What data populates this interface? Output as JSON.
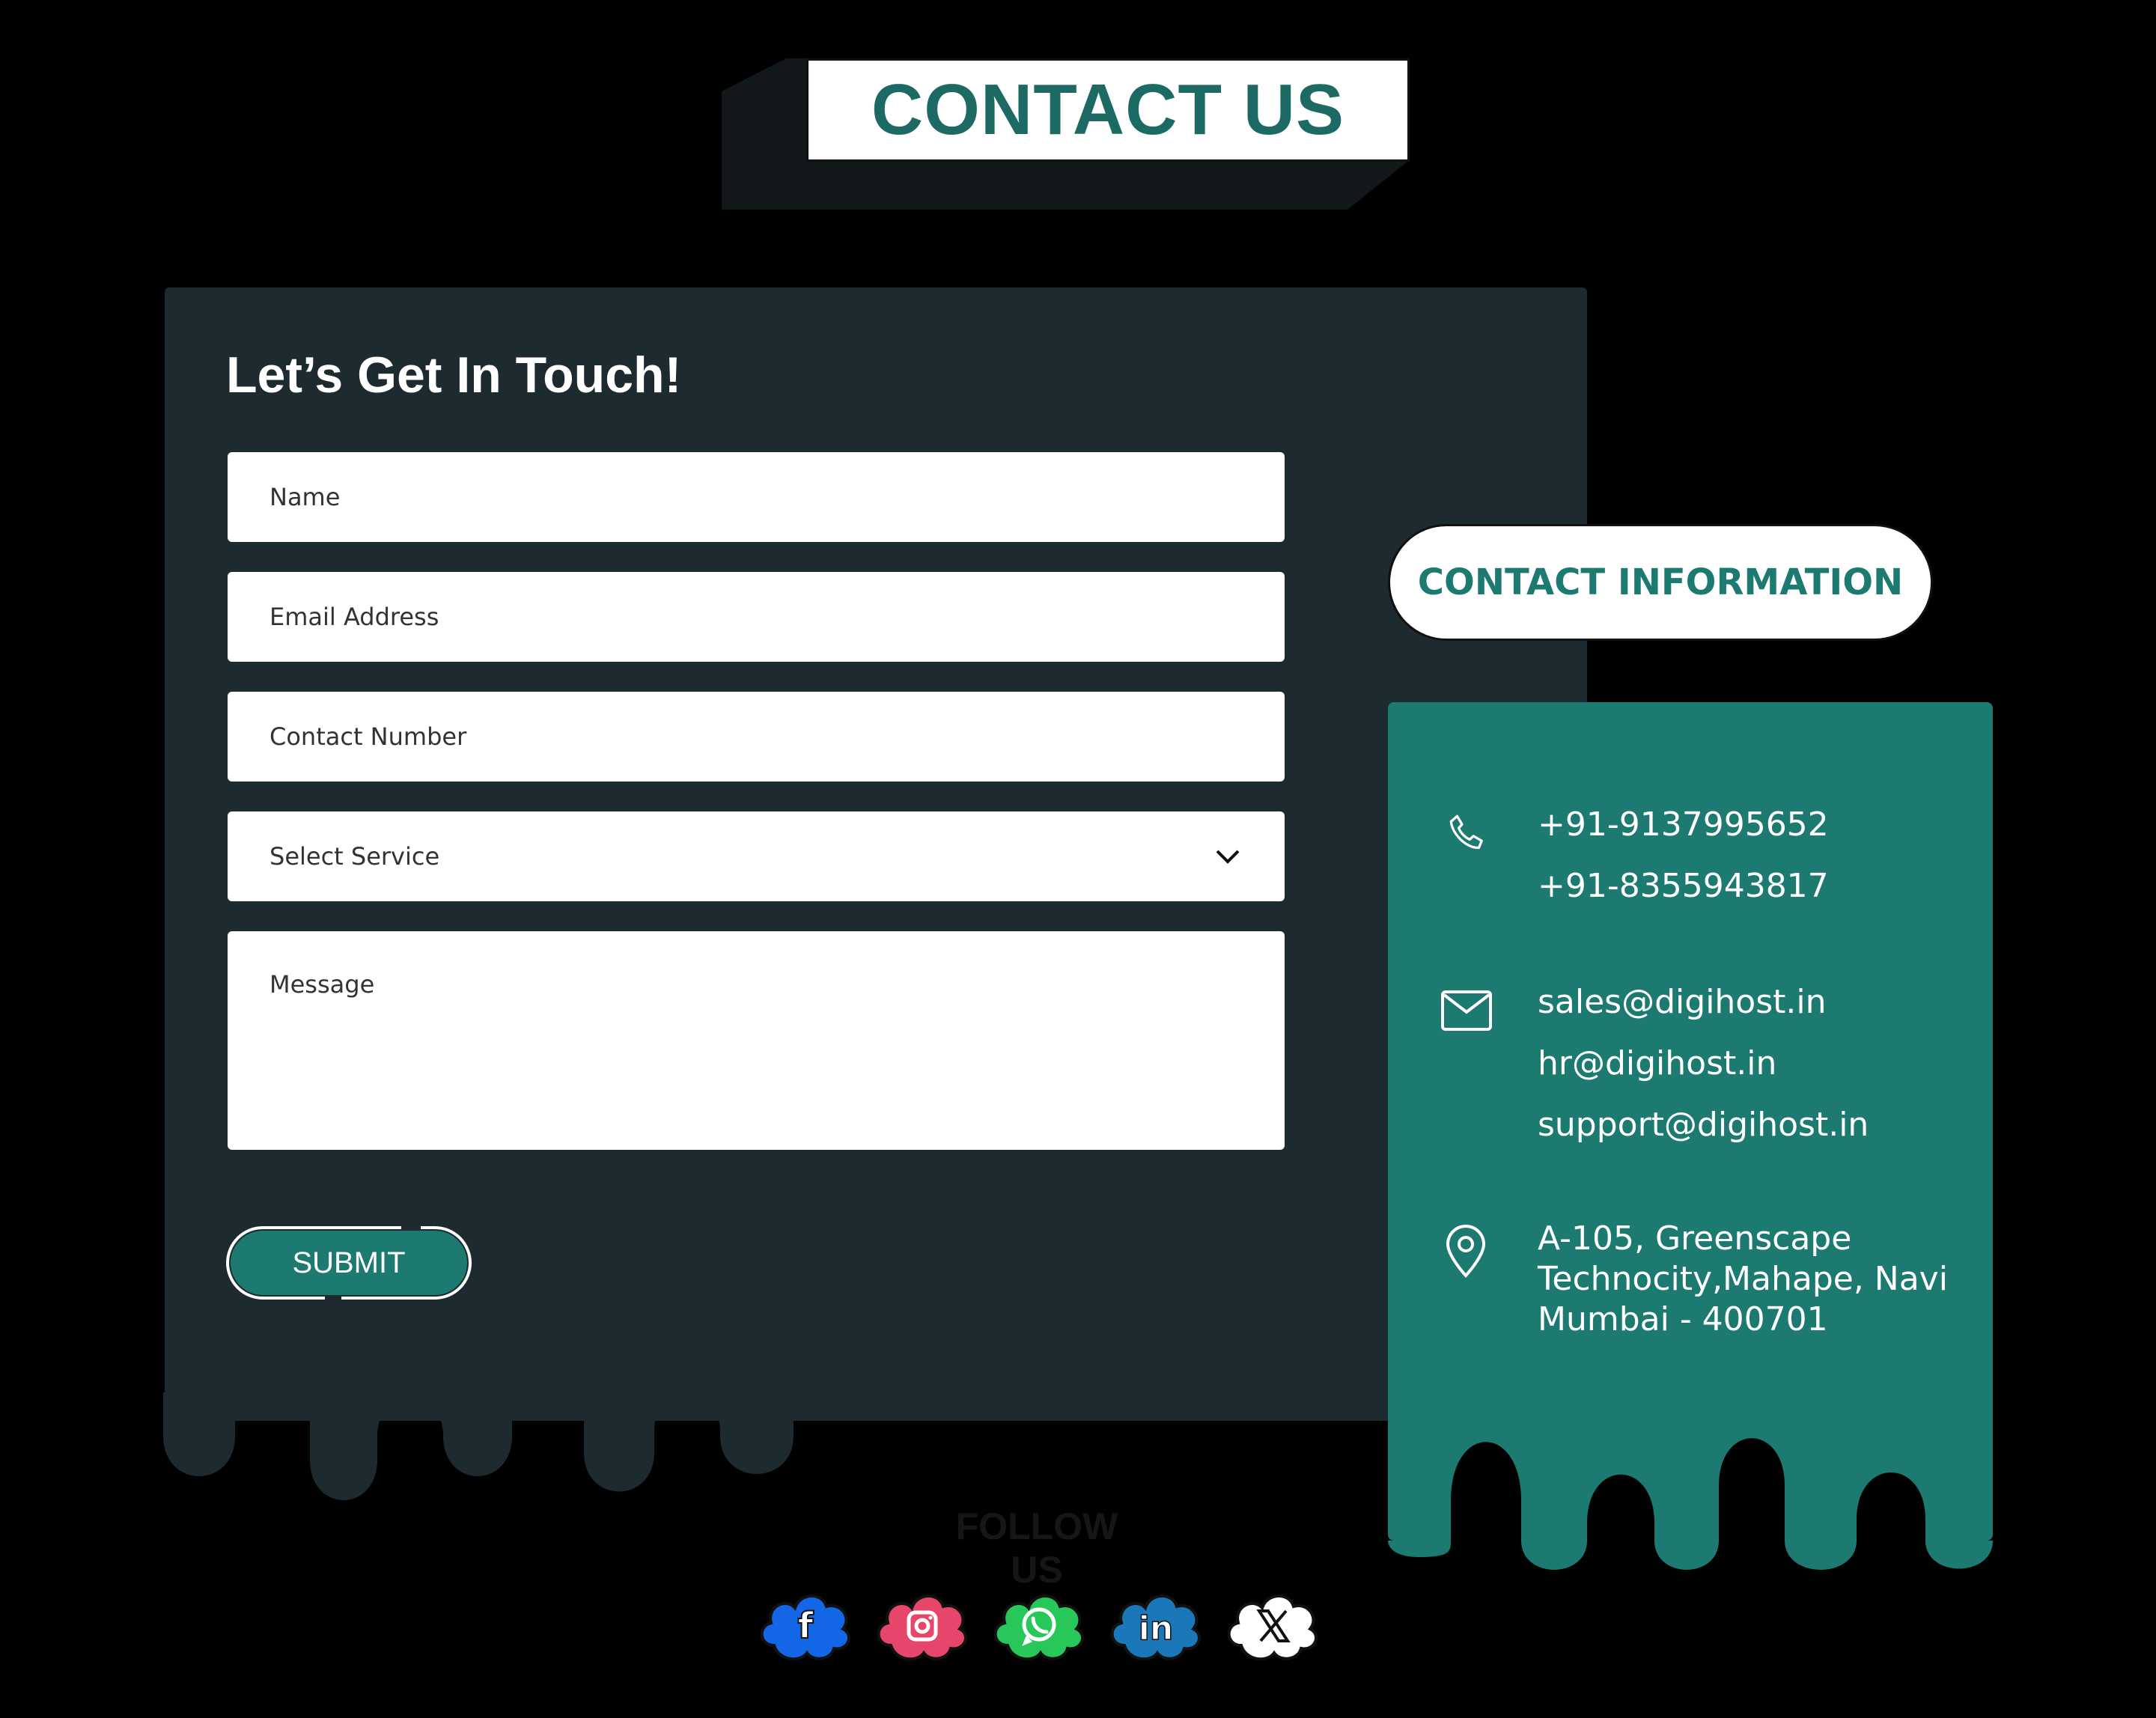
{
  "header": {
    "title": "CONTACT US"
  },
  "form": {
    "heading": "Let’s Get In Touch!",
    "name_placeholder": "Name",
    "email_placeholder": "Email Address",
    "phone_placeholder": "Contact Number",
    "service_selected": "Select Service",
    "message_placeholder": "Message",
    "submit_label": "SUBMIT"
  },
  "contact_info": {
    "title": "CONTACT INFORMATION",
    "phones": [
      "+91-9137995652",
      "+91-8355943817"
    ],
    "emails": [
      "sales@digihost.in",
      "hr@digihost.in",
      "support@digihost.in"
    ],
    "address_lines": [
      "A-105, Greenscape",
      "Technocity,Mahape, Navi",
      "Mumbai - 400701"
    ]
  },
  "follow": {
    "label": "FOLLOW US",
    "icons": [
      {
        "name": "facebook-icon",
        "color": "#1366e6"
      },
      {
        "name": "instagram-icon",
        "color": "#e5466a"
      },
      {
        "name": "whatsapp-icon",
        "color": "#28c75a"
      },
      {
        "name": "linkedin-icon",
        "color": "#1a78b8"
      },
      {
        "name": "x-icon",
        "color": "#ffffff"
      }
    ]
  },
  "colors": {
    "background": "#000000",
    "card": "#1d2a30",
    "accent": "#1d7a70",
    "title": "#1d6a65"
  }
}
